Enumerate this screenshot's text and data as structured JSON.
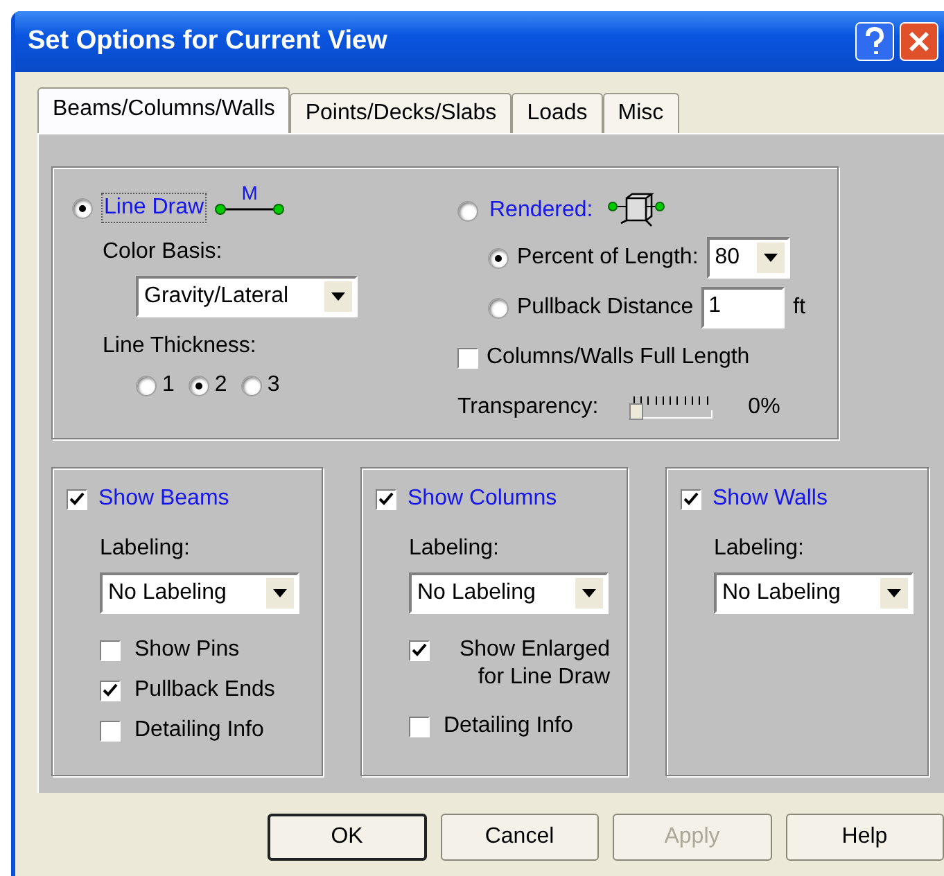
{
  "window": {
    "title": "Set Options for Current View"
  },
  "tabs": [
    {
      "label": "Beams/Columns/Walls",
      "selected": true
    },
    {
      "label": "Points/Decks/Slabs",
      "selected": false
    },
    {
      "label": "Loads",
      "selected": false
    },
    {
      "label": "Misc",
      "selected": false
    }
  ],
  "display": {
    "line_draw": {
      "label": "Line Draw",
      "selected": true,
      "focused": true,
      "icon_label": "M"
    },
    "color_basis": {
      "label": "Color Basis:",
      "value": "Gravity/Lateral"
    },
    "line_thickness": {
      "label": "Line Thickness:",
      "options": [
        {
          "label": "1",
          "selected": false
        },
        {
          "label": "2",
          "selected": true
        },
        {
          "label": "3",
          "selected": false
        }
      ]
    },
    "rendered": {
      "label": "Rendered:",
      "selected": false
    },
    "percent_of_length": {
      "label": "Percent of Length:",
      "selected": true,
      "value": "80"
    },
    "pullback_distance": {
      "label": "Pullback Distance",
      "selected": false,
      "value": "1",
      "unit": "ft"
    },
    "full_length": {
      "label": "Columns/Walls Full Length",
      "checked": false
    },
    "transparency": {
      "label": "Transparency:",
      "level": 0,
      "reading": "0%"
    }
  },
  "groups": [
    {
      "title": "Show Beams",
      "checked": true,
      "labeling_label": "Labeling:",
      "labeling_value": "No Labeling",
      "options": [
        {
          "label": "Show Pins",
          "checked": false
        },
        {
          "label": "Pullback Ends",
          "checked": true
        },
        {
          "label": "Detailing Info",
          "checked": false
        }
      ]
    },
    {
      "title": "Show Columns",
      "checked": true,
      "labeling_label": "Labeling:",
      "labeling_value": "No Labeling",
      "options": [
        {
          "label": "Show Enlarged for Line Draw",
          "checked": true
        },
        {
          "label": "Detailing Info",
          "checked": false
        }
      ]
    },
    {
      "title": "Show Walls",
      "checked": true,
      "labeling_label": "Labeling:",
      "labeling_value": "No Labeling"
    }
  ],
  "buttons": [
    {
      "label": "OK",
      "default": true,
      "disabled": false
    },
    {
      "label": "Cancel",
      "default": false,
      "disabled": false
    },
    {
      "label": "Apply",
      "default": false,
      "disabled": true
    },
    {
      "label": "Help",
      "default": false,
      "disabled": false
    }
  ]
}
